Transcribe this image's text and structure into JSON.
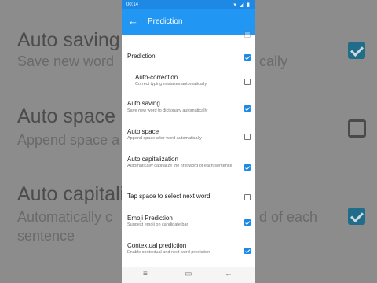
{
  "status": {
    "time": "00:14",
    "icons": "▾ ◢ ▮"
  },
  "appbar": {
    "title": "Prediction",
    "back_glyph": "←"
  },
  "items": [
    {
      "title": "",
      "subtitle": "",
      "checked": false,
      "partial": true
    },
    {
      "title": "Prediction",
      "subtitle": "",
      "checked": true
    },
    {
      "title": "Auto-correction",
      "subtitle": "Correct typing mistakes automatically",
      "checked": false
    },
    {
      "title": "Auto saving",
      "subtitle": "Save new word to dictionary automatically",
      "checked": true
    },
    {
      "title": "Auto space",
      "subtitle": "Append space after word automatically",
      "checked": false
    },
    {
      "title": "Auto capitalization",
      "subtitle": "Automatically capitalize the first word of each sentence",
      "checked": true
    },
    {
      "title": "Tap space to select next word",
      "subtitle": "",
      "checked": false
    },
    {
      "title": "Emoji Prediction",
      "subtitle": "Suggest emoji on candidate bar",
      "checked": true
    },
    {
      "title": "Contextual prediction",
      "subtitle": "Enable contextual and next word prediction",
      "checked": true
    }
  ],
  "navbar": {
    "menu_glyph": "≡",
    "home_glyph": "▭",
    "back_glyph": "←"
  },
  "background": {
    "t1": "Auto saving",
    "s1": "Save new word",
    "s1b": "cally",
    "t2": "Auto space",
    "s2": "Append space a",
    "t3": "Auto capitali",
    "s3": "Automatically c",
    "s3b": "d of each",
    "s3c": "sentence"
  },
  "colors": {
    "accent": "#1e88e5",
    "appbar": "#2196f3"
  }
}
